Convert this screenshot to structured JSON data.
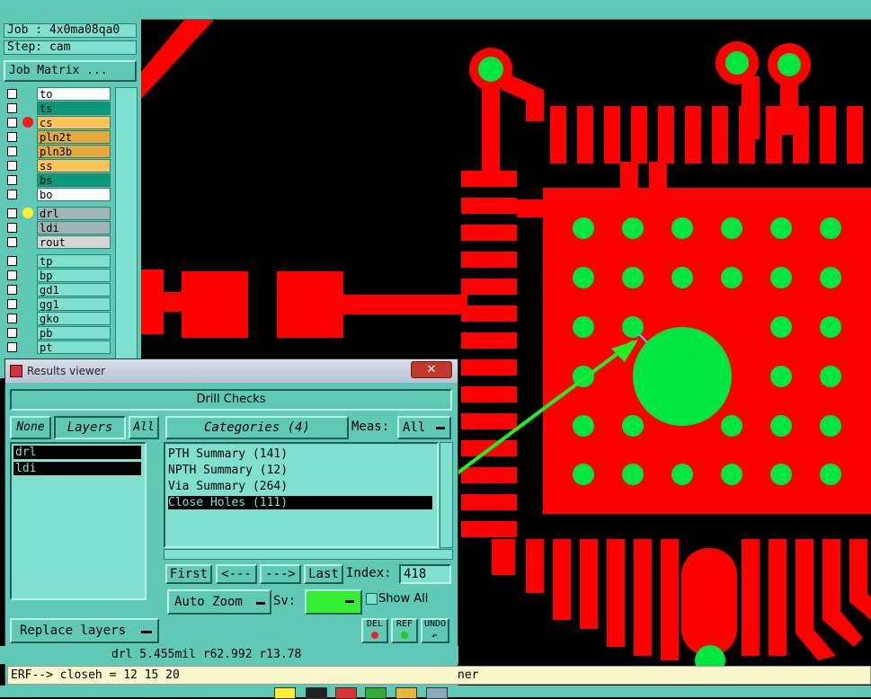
{
  "job_panel": {
    "job_label": "Job : 4x0ma08qa0",
    "step_label": "Step: cam",
    "job_matrix_button": "Job Matrix ..."
  },
  "layers": [
    {
      "name": "to",
      "color": "#ffffff",
      "dot": ""
    },
    {
      "name": "ts",
      "color": "#0a9a7a",
      "dot": ""
    },
    {
      "name": "cs",
      "color": "#ffc357",
      "dot": "#ff1a1a"
    },
    {
      "name": "pln2t",
      "color": "#e3a93a",
      "dot": ""
    },
    {
      "name": "pln3b",
      "color": "#e3a93a",
      "dot": ""
    },
    {
      "name": "ss",
      "color": "#ffc357",
      "dot": ""
    },
    {
      "name": "bs",
      "color": "#0a9a7a",
      "dot": ""
    },
    {
      "name": "bo",
      "color": "#ffffff",
      "dot": ""
    },
    {
      "name": "drl",
      "color": "#9fb4b4",
      "dot": "#ffee33"
    },
    {
      "name": "ldi",
      "color": "#9fb4b4",
      "dot": ""
    },
    {
      "name": "rout",
      "color": "#d6d6d6",
      "dot": ""
    },
    {
      "name": "tp",
      "color": "#7fe0cf",
      "dot": ""
    },
    {
      "name": "bp",
      "color": "#7fe0cf",
      "dot": ""
    },
    {
      "name": "gd1",
      "color": "#7fe0cf",
      "dot": ""
    },
    {
      "name": "gg1",
      "color": "#7fe0cf",
      "dot": ""
    },
    {
      "name": "gko",
      "color": "#7fe0cf",
      "dot": ""
    },
    {
      "name": "pb",
      "color": "#7fe0cf",
      "dot": ""
    },
    {
      "name": "pt",
      "color": "#7fe0cf",
      "dot": ""
    }
  ],
  "results_viewer": {
    "window_title": "Results viewer",
    "close_glyph": "✕",
    "header": "Drill Checks",
    "none_button": "None",
    "layers_label": "Layers",
    "all_button": "All",
    "layer_items": [
      "drl",
      "ldi"
    ],
    "categories_label": "Categories (4)",
    "meas_label": "Meas:",
    "meas_value": "All",
    "categories": [
      "PTH Summary (141)",
      "NPTH Summary (12)",
      "Via Summary (264)",
      "Close Holes (111)"
    ],
    "selected_category": 3,
    "nav": {
      "first": "First",
      "prev": "<---",
      "next": "--->",
      "last": "Last"
    },
    "index_label": "Index:",
    "index_value": "418",
    "auto_zoom": "Auto Zoom",
    "sv_label": "Sv:",
    "show_all": "Show All",
    "replace_layers": "Replace layers",
    "del_button": "DEL",
    "ref_button": "REF",
    "undo_button": "UNDO"
  },
  "status_line": "drl  5.455mil  r62.992  r13.78",
  "erf_line": "ERF--> closeh = 12 15 20",
  "erf_tail": "ner",
  "colors": {
    "pad": "#ff0000",
    "drill": "#00e640",
    "panel": "#5fc9b6",
    "canvas": "#000000"
  }
}
